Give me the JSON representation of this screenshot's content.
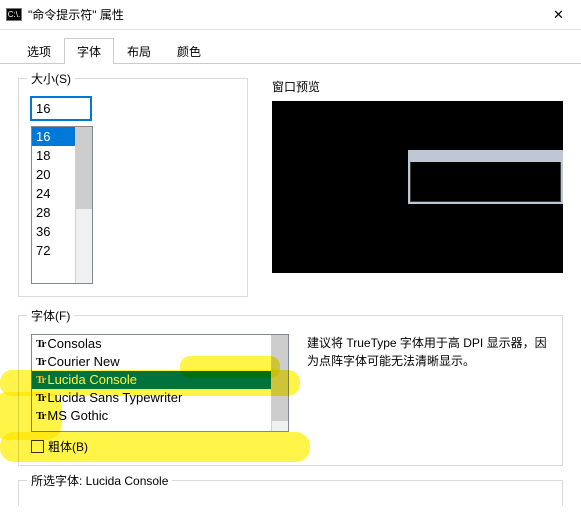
{
  "window": {
    "title": "\"命令提示符\" 属性",
    "close_glyph": "✕",
    "icon_glyph": "C:\\."
  },
  "tabs": {
    "t0": "选项",
    "t1": "字体",
    "t2": "布局",
    "t3": "颜色",
    "active": 1
  },
  "size": {
    "label": "大小(S)",
    "value": "16",
    "options": {
      "o0": "16",
      "o1": "18",
      "o2": "20",
      "o3": "24",
      "o4": "28",
      "o5": "36",
      "o6": "72"
    }
  },
  "preview": {
    "label": "窗口预览"
  },
  "fonts": {
    "label": "字体(F)",
    "list": {
      "f0": "Consolas",
      "f1": "Courier New",
      "f2": "Lucida Console",
      "f3": "Lucida Sans Typewriter",
      "f4": "MS Gothic"
    },
    "hint": "建议将 TrueType 字体用于高 DPI 显示器，因为点阵字体可能无法清晰显示。",
    "bold": "粗体(B)"
  },
  "selected": {
    "label": "所选字体: Lucida Console"
  }
}
